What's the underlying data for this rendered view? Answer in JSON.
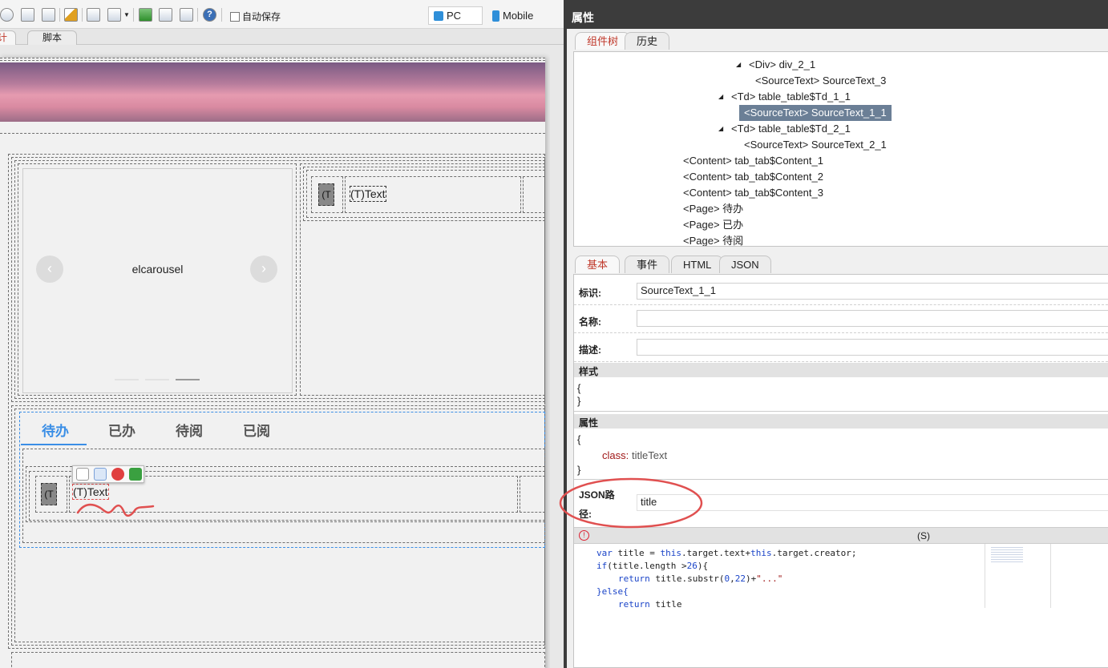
{
  "toolbar": {
    "autosave_label": "自动保存",
    "device_pc": "PC",
    "device_mobile": "Mobile"
  },
  "left_tabs": {
    "design": "计",
    "script": "脚本"
  },
  "canvas": {
    "carousel_label": "elcarousel",
    "carousel_prev": "‹",
    "carousel_next": "›",
    "text_small": "(T",
    "text_item": "(T)Text",
    "vue_tabs": [
      "待办",
      "已办",
      "待阅",
      "已阅"
    ]
  },
  "right_panel": {
    "title": "属性",
    "top_tabs": {
      "tree": "组件树",
      "history": "历史"
    },
    "tree": [
      {
        "text": "<Div> div_2_1",
        "expand": true
      },
      {
        "text": "<SourceText> SourceText_3",
        "expand": false
      },
      {
        "text": "<Td> table_table$Td_1_1",
        "expand": true
      },
      {
        "text": "<SourceText> SourceText_1_1",
        "expand": false,
        "selected": true
      },
      {
        "text": "<Td> table_table$Td_2_1",
        "expand": true
      },
      {
        "text": "<SourceText> SourceText_2_1",
        "expand": false
      },
      {
        "text": "<Content> tab_tab$Content_1",
        "expand": false
      },
      {
        "text": "<Content> tab_tab$Content_2",
        "expand": false
      },
      {
        "text": "<Content> tab_tab$Content_3",
        "expand": false
      },
      {
        "text": "<Page> 待办",
        "expand": false
      },
      {
        "text": "<Page> 已办",
        "expand": false
      },
      {
        "text": "<Page> 待阅",
        "expand": false
      }
    ],
    "prop_tabs": {
      "basic": "基本",
      "event": "事件",
      "html": "HTML",
      "json": "JSON"
    },
    "fields": {
      "id_label": "标识:",
      "id_value": "SourceText_1_1",
      "name_label": "名称:",
      "desc_label": "描述:"
    },
    "style": {
      "header": "样式",
      "open": "{",
      "close": "}"
    },
    "attrs": {
      "header": "属性",
      "open": "{",
      "key": "class:",
      "value": "titleText",
      "close": "}"
    },
    "json_path": {
      "label_line1": "JSON路",
      "label_line2": "径:",
      "value": "title"
    },
    "script_bar": {
      "error_icon": "!",
      "label": "(S)"
    },
    "code": {
      "l1a": "var",
      "l1b": " title = ",
      "l1c": "this",
      "l1d": ".target.text+",
      "l1e": "this",
      "l1f": ".target.creator;",
      "l2a": "if",
      "l2b": "(title.length >",
      "l2c": "26",
      "l2d": "){",
      "l3a": "return",
      "l3b": " title.substr(",
      "l3c": "0",
      "l3d": ",",
      "l3e": "22",
      "l3f": ")+",
      "l3g": "\"...\"",
      "l4a": "}else{",
      "l5a": "return",
      "l5b": " title"
    }
  },
  "colors": {
    "accent_tab": "#3a8ee6",
    "selected_node": "#6b7f96",
    "annotation": "#e05050"
  }
}
